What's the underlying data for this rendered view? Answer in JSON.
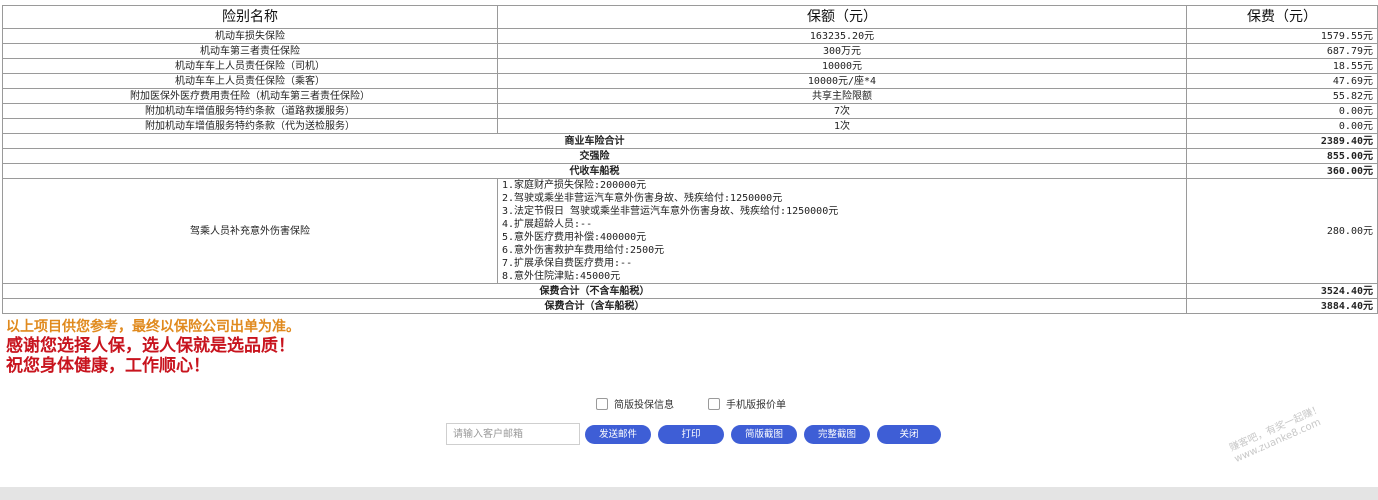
{
  "table": {
    "headers": [
      "险别名称",
      "保额（元）",
      "保费（元）"
    ],
    "rows": [
      {
        "name": "机动车损失保险",
        "amount": "163235.20元",
        "premium": "1579.55元"
      },
      {
        "name": "机动车第三者责任保险",
        "amount": "300万元",
        "premium": "687.79元"
      },
      {
        "name": "机动车车上人员责任保险（司机）",
        "amount": "10000元",
        "premium": "18.55元"
      },
      {
        "name": "机动车车上人员责任保险（乘客）",
        "amount": "10000元/座*4",
        "premium": "47.69元"
      },
      {
        "name": "附加医保外医疗费用责任险（机动车第三者责任保险）",
        "amount": "共享主险限额",
        "premium": "55.82元"
      },
      {
        "name": "附加机动车增值服务特约条款（道路救援服务）",
        "amount": "7次",
        "premium": "0.00元"
      },
      {
        "name": "附加机动车增值服务特约条款（代为送检服务）",
        "amount": "1次",
        "premium": "0.00元"
      }
    ],
    "subtotals": [
      {
        "label": "商业车险合计",
        "premium": "2389.40元"
      },
      {
        "label": "交强险",
        "premium": "855.00元"
      },
      {
        "label": "代收车船税",
        "premium": "360.00元"
      }
    ],
    "accident": {
      "name": "驾乘人员补充意外伤害保险",
      "details": [
        "1.家庭财产损失保险:200000元",
        "2.驾驶或乘坐非营运汽车意外伤害身故、残疾给付:1250000元",
        "3.法定节假日 驾驶或乘坐非营运汽车意外伤害身故、残疾给付:1250000元",
        "4.扩展超龄人员:--",
        "5.意外医疗费用补偿:400000元",
        "6.意外伤害救护车费用给付:2500元",
        "7.扩展承保自费医疗费用:--",
        "8.意外住院津贴:45000元"
      ],
      "premium": "280.00元"
    },
    "totals": [
      {
        "label": "保费合计（不含车船税）",
        "premium": "3524.40元"
      },
      {
        "label": "保费合计（含车船税）",
        "premium": "3884.40元"
      }
    ]
  },
  "notes": {
    "line1": "以上项目供您参考，最终以保险公司出单为准。",
    "line2": "感谢您选择人保，选人保就是选品质！",
    "line3": "祝您身体健康，工作顺心！"
  },
  "options": {
    "simple_info": "简版投保信息",
    "mobile_quote": "手机版报价单"
  },
  "email": {
    "placeholder": "请输入客户邮箱",
    "value": ""
  },
  "buttons": {
    "send_email": "发送邮件",
    "print": "打印",
    "simple_screenshot": "简版截图",
    "full_screenshot": "完整截图",
    "close": "关闭"
  },
  "watermark": {
    "line1": "赚客吧，有奖一起赚！",
    "line2": "www.zuanke8.com"
  }
}
